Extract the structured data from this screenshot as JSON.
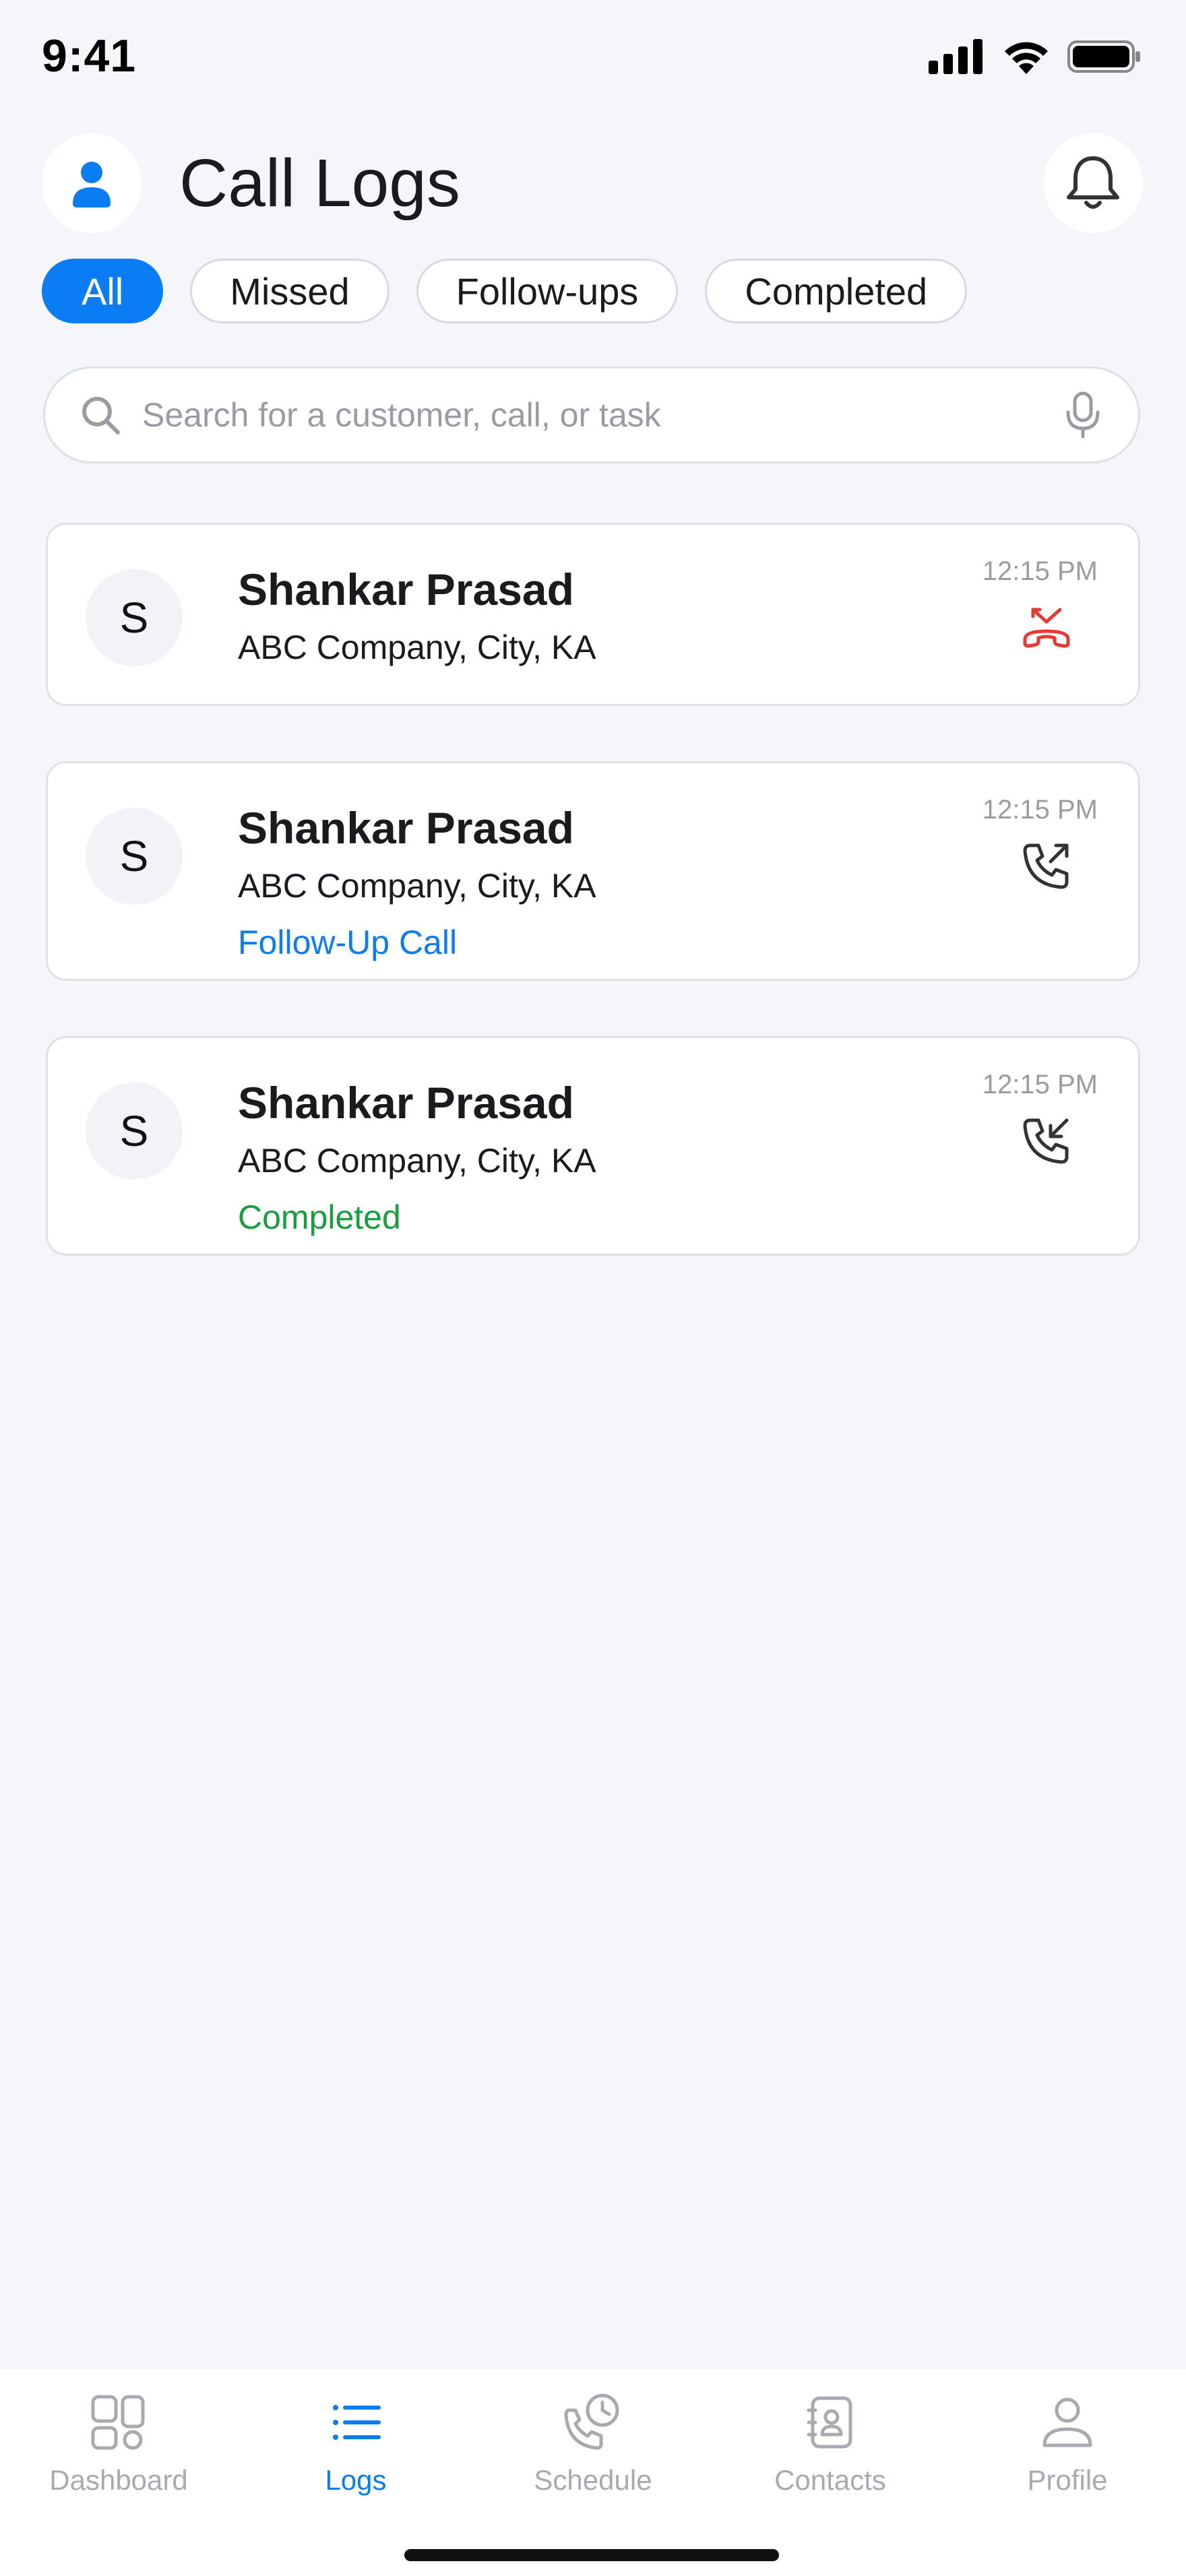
{
  "status_bar": {
    "time": "9:41"
  },
  "header": {
    "title": "Call Logs",
    "avatar_icon": "user-icon",
    "notification_icon": "bell-icon"
  },
  "filters": [
    {
      "label": "All",
      "active": true
    },
    {
      "label": "Missed",
      "active": false
    },
    {
      "label": "Follow-ups",
      "active": false
    },
    {
      "label": "Completed",
      "active": false
    }
  ],
  "search": {
    "placeholder": "Search for a customer, call, or task",
    "value": ""
  },
  "calls": [
    {
      "initial": "S",
      "name": "Shankar Prasad",
      "company": "ABC Company, City, KA",
      "time": "12:15 PM",
      "type_icon": "missed-call-icon",
      "tag": ""
    },
    {
      "initial": "S",
      "name": "Shankar Prasad",
      "company": "ABC Company, City, KA",
      "time": "12:15 PM",
      "type_icon": "outgoing-call-icon",
      "tag": "Follow-Up Call"
    },
    {
      "initial": "S",
      "name": "Shankar Prasad",
      "company": "ABC Company, City, KA",
      "time": "12:15 PM",
      "type_icon": "incoming-call-icon",
      "tag": "Completed"
    }
  ],
  "nav": [
    {
      "label": "Dashboard",
      "icon": "dashboard-icon",
      "active": false
    },
    {
      "label": "Logs",
      "icon": "list-icon",
      "active": true
    },
    {
      "label": "Schedule",
      "icon": "schedule-icon",
      "active": false
    },
    {
      "label": "Contacts",
      "icon": "contacts-icon",
      "active": false
    },
    {
      "label": "Profile",
      "icon": "profile-icon",
      "active": false
    }
  ],
  "colors": {
    "accent": "#0a7df5",
    "missed": "#e53935",
    "completed": "#1a9e3d",
    "background": "#f5f6fa"
  }
}
